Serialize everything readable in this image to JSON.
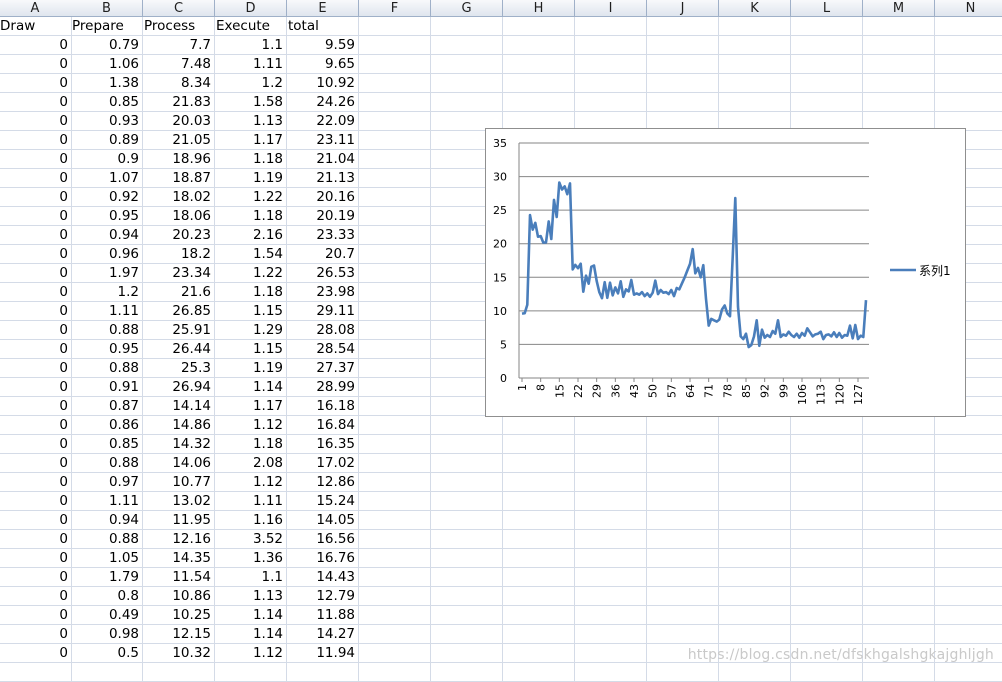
{
  "sheet": {
    "columns": [
      "A",
      "B",
      "C",
      "D",
      "E",
      "F",
      "G",
      "H",
      "I",
      "J",
      "K",
      "L",
      "M",
      "N"
    ],
    "table_headers": [
      "Draw",
      "Prepare",
      "Process",
      "Execute",
      "total"
    ],
    "rows": [
      [
        "0",
        "0.79",
        "7.7",
        "1.1",
        "9.59"
      ],
      [
        "0",
        "1.06",
        "7.48",
        "1.11",
        "9.65"
      ],
      [
        "0",
        "1.38",
        "8.34",
        "1.2",
        "10.92"
      ],
      [
        "0",
        "0.85",
        "21.83",
        "1.58",
        "24.26"
      ],
      [
        "0",
        "0.93",
        "20.03",
        "1.13",
        "22.09"
      ],
      [
        "0",
        "0.89",
        "21.05",
        "1.17",
        "23.11"
      ],
      [
        "0",
        "0.9",
        "18.96",
        "1.18",
        "21.04"
      ],
      [
        "0",
        "1.07",
        "18.87",
        "1.19",
        "21.13"
      ],
      [
        "0",
        "0.92",
        "18.02",
        "1.22",
        "20.16"
      ],
      [
        "0",
        "0.95",
        "18.06",
        "1.18",
        "20.19"
      ],
      [
        "0",
        "0.94",
        "20.23",
        "2.16",
        "23.33"
      ],
      [
        "0",
        "0.96",
        "18.2",
        "1.54",
        "20.7"
      ],
      [
        "0",
        "1.97",
        "23.34",
        "1.22",
        "26.53"
      ],
      [
        "0",
        "1.2",
        "21.6",
        "1.18",
        "23.98"
      ],
      [
        "0",
        "1.11",
        "26.85",
        "1.15",
        "29.11"
      ],
      [
        "0",
        "0.88",
        "25.91",
        "1.29",
        "28.08"
      ],
      [
        "0",
        "0.95",
        "26.44",
        "1.15",
        "28.54"
      ],
      [
        "0",
        "0.88",
        "25.3",
        "1.19",
        "27.37"
      ],
      [
        "0",
        "0.91",
        "26.94",
        "1.14",
        "28.99"
      ],
      [
        "0",
        "0.87",
        "14.14",
        "1.17",
        "16.18"
      ],
      [
        "0",
        "0.86",
        "14.86",
        "1.12",
        "16.84"
      ],
      [
        "0",
        "0.85",
        "14.32",
        "1.18",
        "16.35"
      ],
      [
        "0",
        "0.88",
        "14.06",
        "2.08",
        "17.02"
      ],
      [
        "0",
        "0.97",
        "10.77",
        "1.12",
        "12.86"
      ],
      [
        "0",
        "1.11",
        "13.02",
        "1.11",
        "15.24"
      ],
      [
        "0",
        "0.94",
        "11.95",
        "1.16",
        "14.05"
      ],
      [
        "0",
        "0.88",
        "12.16",
        "3.52",
        "16.56"
      ],
      [
        "0",
        "1.05",
        "14.35",
        "1.36",
        "16.76"
      ],
      [
        "0",
        "1.79",
        "11.54",
        "1.1",
        "14.43"
      ],
      [
        "0",
        "0.8",
        "10.86",
        "1.13",
        "12.79"
      ],
      [
        "0",
        "0.49",
        "10.25",
        "1.14",
        "11.88"
      ],
      [
        "0",
        "0.98",
        "12.15",
        "1.14",
        "14.27"
      ],
      [
        "0",
        "0.5",
        "10.32",
        "1.12",
        "11.94"
      ]
    ]
  },
  "chart_data": {
    "type": "line",
    "ylim": [
      0,
      35
    ],
    "yticks": [
      0,
      5,
      10,
      15,
      20,
      25,
      30,
      35
    ],
    "xticks": [
      "1",
      "8",
      "15",
      "22",
      "29",
      "36",
      "43",
      "50",
      "57",
      "64",
      "71",
      "78",
      "85",
      "92",
      "99",
      "106",
      "113",
      "120",
      "127"
    ],
    "legend": "right",
    "grid": true,
    "color": "#4a7ebb",
    "series": [
      {
        "name": "系列1",
        "values": [
          9.59,
          9.65,
          10.92,
          24.26,
          22.09,
          23.11,
          21.04,
          21.13,
          20.16,
          20.19,
          23.33,
          20.7,
          26.53,
          23.98,
          29.11,
          28.08,
          28.54,
          27.37,
          28.99,
          16.18,
          16.84,
          16.35,
          17.02,
          12.86,
          15.24,
          14.05,
          16.56,
          16.76,
          14.43,
          12.79,
          11.88,
          14.27,
          11.94,
          14.2,
          12.3,
          13.5,
          12.6,
          14.4,
          12.1,
          13.2,
          12.9,
          14.6,
          12.4,
          12.6,
          12.4,
          12.8,
          12.2,
          12.6,
          12.1,
          12.7,
          14.5,
          12.5,
          13.1,
          12.7,
          12.8,
          12.5,
          13.1,
          12.2,
          13.4,
          13.2,
          14.1,
          15.0,
          16.0,
          17.0,
          19.2,
          15.6,
          16.4,
          15.0,
          16.8,
          11.8,
          7.8,
          8.8,
          8.6,
          8.4,
          8.7,
          10.2,
          10.8,
          9.6,
          9.2,
          18.0,
          26.8,
          10.6,
          6.2,
          5.8,
          6.6,
          4.6,
          4.9,
          6.2,
          8.6,
          4.8,
          7.2,
          6.0,
          6.4,
          6.1,
          7.0,
          6.6,
          8.6,
          6.1,
          6.5,
          6.3,
          6.9,
          6.4,
          6.1,
          6.6,
          6.0,
          6.7,
          6.3,
          7.4,
          6.8,
          6.2,
          6.5,
          6.6,
          6.9,
          5.8,
          6.4,
          6.5,
          6.2,
          6.8,
          6.1,
          6.7,
          6.0,
          6.4,
          6.3,
          7.8,
          5.9,
          7.9,
          5.8,
          6.3,
          6.1,
          11.6
        ]
      }
    ]
  },
  "watermark": "https://blog.csdn.net/dfskhgalshgkajghljgh"
}
